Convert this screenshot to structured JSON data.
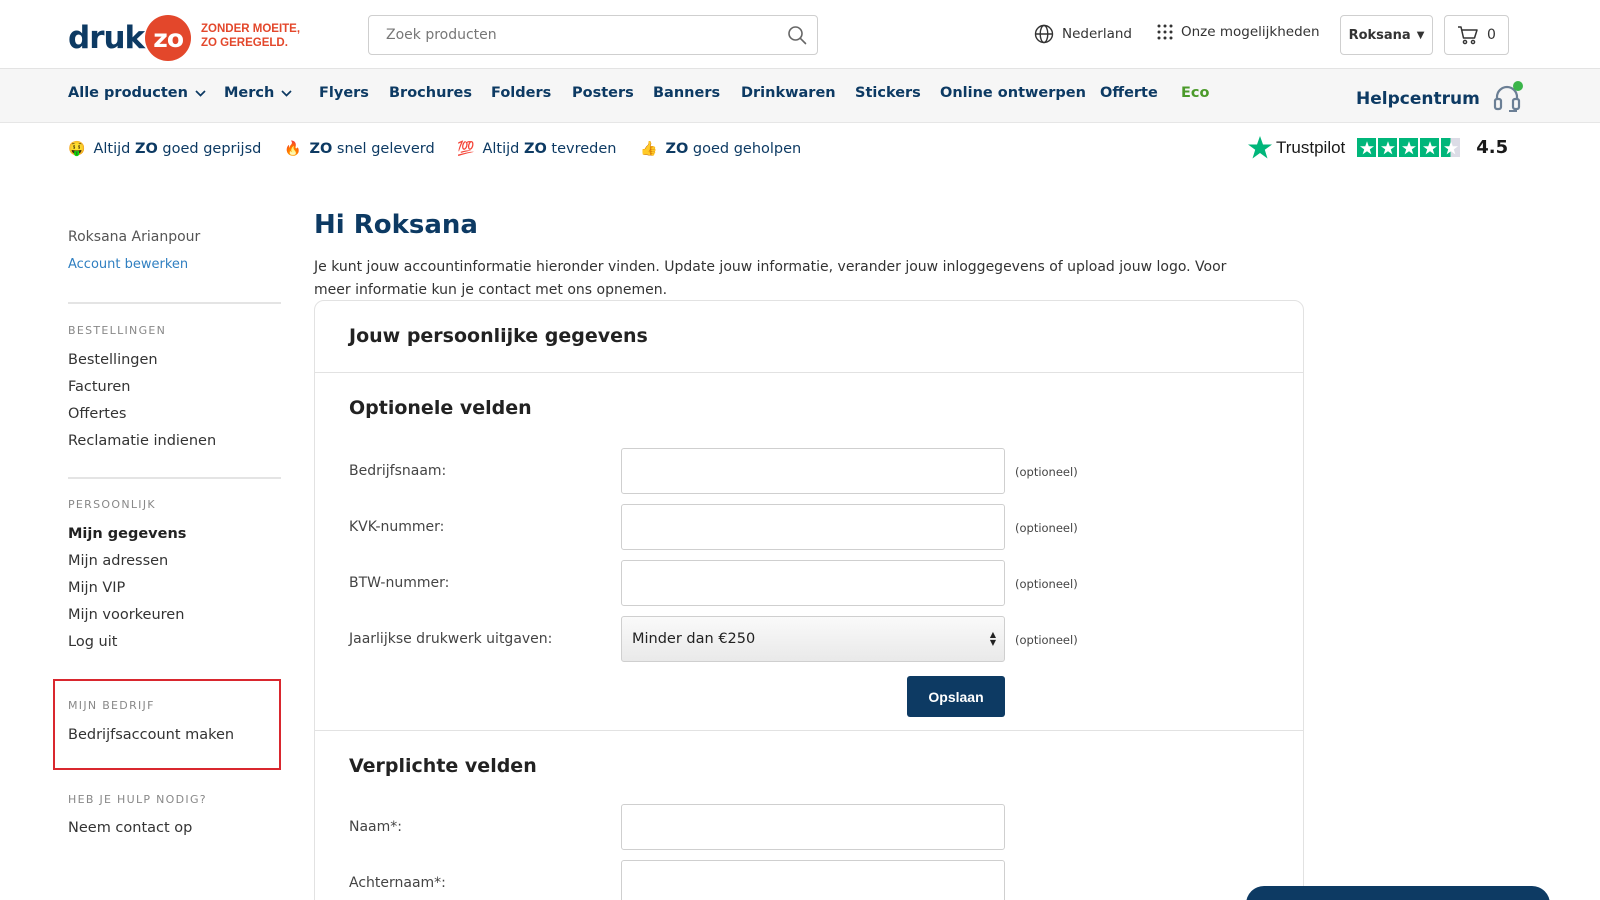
{
  "header": {
    "logo_druk": "druk",
    "logo_zo": "zo",
    "tagline_line1": "ZONDER MOEITE,",
    "tagline_line2": "ZO GEREGELD.",
    "search_placeholder": "Zoek producten",
    "country": "Nederland",
    "options": "Onze mogelijkheden",
    "user": "Roksana",
    "cart_count": "0"
  },
  "nav": {
    "items": [
      "Alle producten",
      "Merch",
      "Flyers",
      "Brochures",
      "Folders",
      "Posters",
      "Banners",
      "Drinkwaren",
      "Stickers",
      "Online ontwerpen",
      "Offerte",
      "Eco"
    ],
    "help": "Helpcentrum"
  },
  "usps": [
    {
      "emoji": "🤑",
      "pre": "Altijd ",
      "bold": "ZO",
      "post": " goed geprijsd"
    },
    {
      "emoji": "🔥",
      "pre": "",
      "bold": "ZO",
      "post": " snel geleverd"
    },
    {
      "emoji": "💯",
      "pre": "Altijd ",
      "bold": "ZO",
      "post": " tevreden"
    },
    {
      "emoji": "👍",
      "pre": "",
      "bold": "ZO",
      "post": " goed geholpen"
    }
  ],
  "trustpilot": {
    "name": "Trustpilot",
    "score": "4.5",
    "rating": 4.5,
    "brand_color": "#00b67a"
  },
  "sidebar": {
    "user_name": "Roksana Arianpour",
    "edit_account": "Account bewerken",
    "sections": {
      "orders": {
        "heading": "BESTELLINGEN",
        "links": [
          "Bestellingen",
          "Facturen",
          "Offertes",
          "Reclamatie indienen"
        ]
      },
      "personal": {
        "heading": "PERSOONLIJK",
        "links": [
          "Mijn gegevens",
          "Mijn adressen",
          "Mijn VIP",
          "Mijn voorkeuren",
          "Log uit"
        ]
      },
      "company": {
        "heading": "MIJN BEDRIJF",
        "links": [
          "Bedrijfsaccount maken"
        ]
      },
      "help": {
        "heading": "HEB JE HULP NODIG?",
        "links": [
          "Neem contact op"
        ]
      }
    }
  },
  "main": {
    "greeting": "Hi Roksana",
    "intro": "Je kunt jouw accountinformatie hieronder vinden. Update jouw informatie, verander jouw inloggegevens of upload jouw logo. Voor meer informatie kun je contact met ons opnemen.",
    "card_title": "Jouw persoonlijke gegevens",
    "optional_title": "Optionele velden",
    "optional_fields": [
      {
        "label": "Bedrijfsnaam:",
        "value": "",
        "note": "(optioneel)"
      },
      {
        "label": "KVK-nummer:",
        "value": "",
        "note": "(optioneel)"
      },
      {
        "label": "BTW-nummer:",
        "value": "",
        "note": "(optioneel)"
      }
    ],
    "spend_label": "Jaarlijkse drukwerk uitgaven:",
    "spend_value": "Minder dan €250",
    "spend_note": "(optioneel)",
    "save_label": "Opslaan",
    "required_title": "Verplichte velden",
    "required_fields": [
      {
        "label": "Naam*:",
        "value": ""
      },
      {
        "label": "Achternaam*:",
        "value": ""
      }
    ]
  },
  "colors": {
    "brand_navy": "#0d3a63",
    "brand_orange": "#e3472b",
    "link_blue": "#2f7fc1",
    "eco_green": "#4b9a2a",
    "highlight_red": "#d9272e"
  }
}
